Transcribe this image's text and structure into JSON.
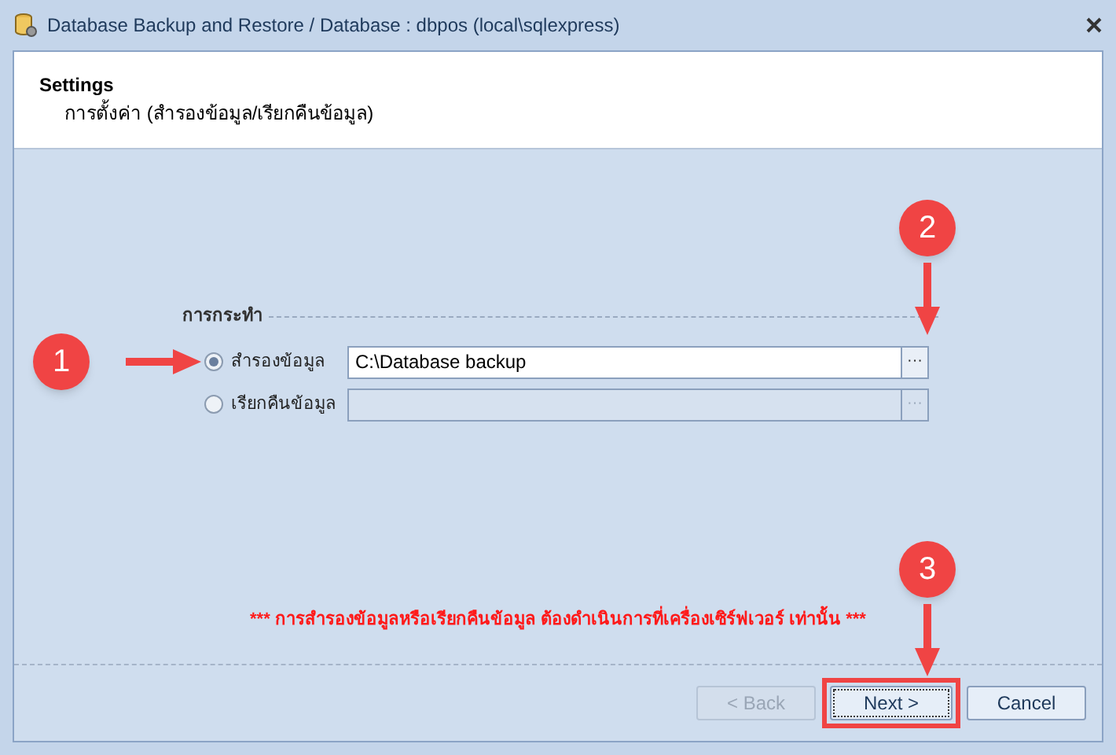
{
  "window": {
    "title": "Database Backup and Restore / Database : dbpos (local\\sqlexpress)"
  },
  "header": {
    "title": "Settings",
    "subtitle": "การตั้งค่า (สำรองข้อมูล/เรียกคืนข้อมูล)"
  },
  "group": {
    "label": "การกระทำ",
    "options": [
      {
        "label": "สำรองข้อมูล",
        "selected": true,
        "path": "C:\\Database backup",
        "browse": "···"
      },
      {
        "label": "เรียกคืนข้อมูล",
        "selected": false,
        "browse": "···"
      }
    ]
  },
  "warning": "*** การสำรองข้อมูลหรือเรียกคืนข้อมูล ต้องดำเนินการที่เครื่องเซิร์ฟเวอร์ เท่านั้น ***",
  "buttons": [
    {
      "label": "< Back",
      "disabled": true,
      "highlighted": false
    },
    {
      "label": "Next >",
      "disabled": false,
      "highlighted": true
    },
    {
      "label": "Cancel",
      "disabled": false,
      "highlighted": false
    }
  ],
  "annotations": [
    {
      "label": "1"
    },
    {
      "label": "2"
    },
    {
      "label": "3"
    }
  ]
}
